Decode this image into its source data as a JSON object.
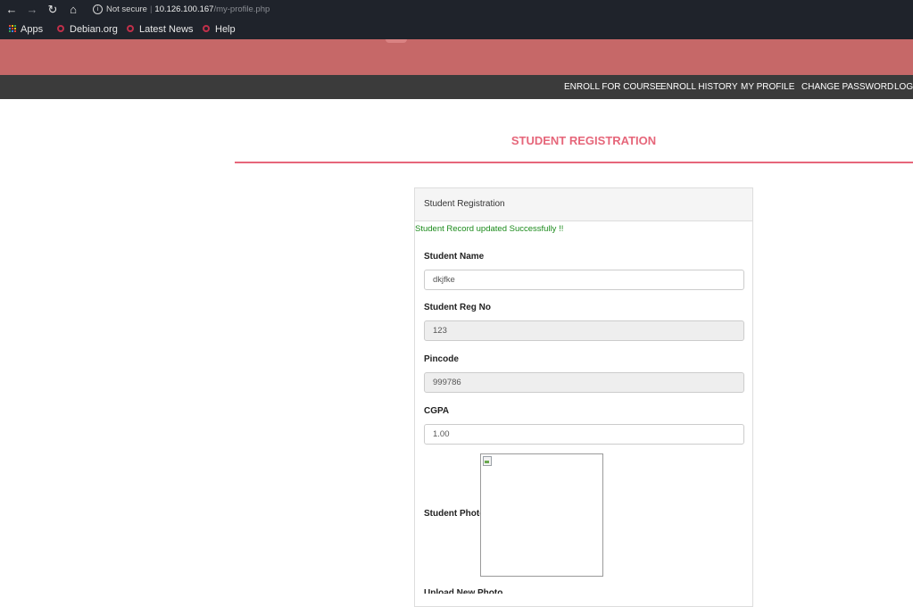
{
  "browser": {
    "security_label": "Not secure",
    "url_host": "10.126.100.167",
    "url_path": "/my-profile.php",
    "bookmarks": [
      {
        "label": "Apps",
        "icon": "apps-grid-icon"
      },
      {
        "label": "Debian.org",
        "icon": "debian-icon"
      },
      {
        "label": "Latest News",
        "icon": "debian-icon"
      },
      {
        "label": "Help",
        "icon": "debian-icon"
      }
    ]
  },
  "nav": {
    "items": [
      {
        "label": "ENROLL FOR COURSE"
      },
      {
        "label": "ENROLL HISTORY"
      },
      {
        "label": "MY PROFILE"
      },
      {
        "label": "CHANGE PASSWORD"
      },
      {
        "label": "LOGO"
      }
    ]
  },
  "page": {
    "title": "STUDENT REGISTRATION"
  },
  "panel": {
    "heading": "Student Registration",
    "success_message": "Student Record updated Successfully !!",
    "fields": {
      "name": {
        "label": "Student Name",
        "value": "dkjfke"
      },
      "reg_no": {
        "label": "Student Reg No",
        "value": "123"
      },
      "pincode": {
        "label": "Pincode",
        "value": "999786"
      },
      "cgpa": {
        "label": "CGPA",
        "value": "1.00"
      },
      "photo": {
        "label": "Student Photo"
      }
    },
    "next_label": "Upload New Photo"
  },
  "colors": {
    "header_bg": "#c66868",
    "menu_bg": "#3b3b3b",
    "accent": "#e6667a",
    "success": "#1a8a1a"
  }
}
